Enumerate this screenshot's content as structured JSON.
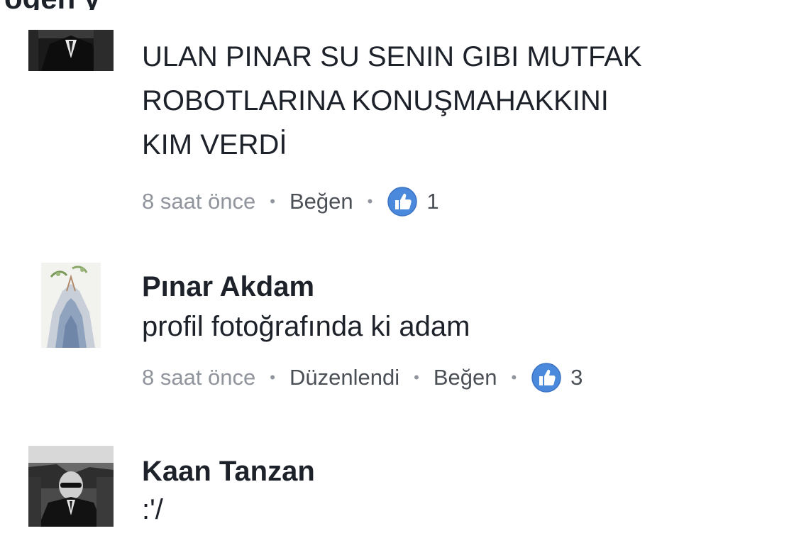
{
  "top_strip": {
    "text": "ogen y"
  },
  "comments": [
    {
      "author": "",
      "text_lines": [
        "ULAN PINAR SU SENIN GIBI MUTFAK",
        "ROBOTLARINA KONUŞMAHAKKINI",
        "KIM VERDİ"
      ],
      "meta": {
        "time": "8 saat önce",
        "like_label": "Beğen",
        "like_count": "1"
      }
    },
    {
      "author": "Pınar Akdam",
      "text_lines": [
        "profil fotoğrafında ki adam"
      ],
      "meta": {
        "time": "8 saat önce",
        "edited": "Düzenlendi",
        "like_label": "Beğen",
        "like_count": "3"
      }
    },
    {
      "author": "Kaan Tanzan",
      "text_lines": [
        ":'/"
      ]
    }
  ],
  "colors": {
    "like_blue": "#4a89dc",
    "meta_gray": "#90949c",
    "text_dark": "#1d2129"
  },
  "icons": {
    "like": "thumbs-up-icon"
  }
}
